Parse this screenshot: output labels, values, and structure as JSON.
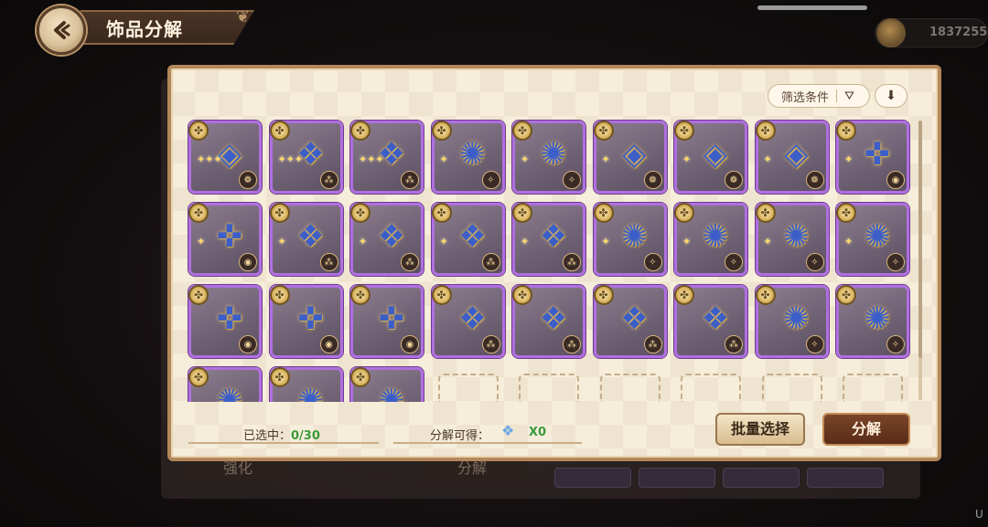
{
  "header": {
    "title": "饰品分解",
    "currency_value": "1837255"
  },
  "toolbar": {
    "filter_label": "筛选条件",
    "filter_icon": "funnel-icon",
    "sort_icon": "down-arrow-icon"
  },
  "items": [
    {
      "kind": "ring",
      "glyph": "◈",
      "badge": "❁",
      "stars": "✦✦✦"
    },
    {
      "kind": "wing",
      "glyph": "❖",
      "badge": "⁂",
      "stars": "✦✦✦"
    },
    {
      "kind": "wing",
      "glyph": "❖",
      "badge": "⁂",
      "stars": "✦✦✦"
    },
    {
      "kind": "wreath",
      "glyph": "✺",
      "badge": "✧",
      "stars": "✦"
    },
    {
      "kind": "wreath",
      "glyph": "✺",
      "badge": "✧",
      "stars": "✦"
    },
    {
      "kind": "ring",
      "glyph": "◈",
      "badge": "❁",
      "stars": "✦"
    },
    {
      "kind": "ring",
      "glyph": "◈",
      "badge": "❁",
      "stars": "✦"
    },
    {
      "kind": "ring",
      "glyph": "◈",
      "badge": "❁",
      "stars": "✦"
    },
    {
      "kind": "staff",
      "glyph": "✜",
      "badge": "◉",
      "stars": "✦"
    },
    {
      "kind": "staff",
      "glyph": "✜",
      "badge": "◉",
      "stars": "✦"
    },
    {
      "kind": "wing",
      "glyph": "❖",
      "badge": "⁂",
      "stars": "✦"
    },
    {
      "kind": "wing",
      "glyph": "❖",
      "badge": "⁂",
      "stars": "✦"
    },
    {
      "kind": "wing",
      "glyph": "❖",
      "badge": "⁂",
      "stars": "✦"
    },
    {
      "kind": "wing",
      "glyph": "❖",
      "badge": "⁂",
      "stars": "✦"
    },
    {
      "kind": "wreath",
      "glyph": "✺",
      "badge": "✧",
      "stars": "✦"
    },
    {
      "kind": "wreath",
      "glyph": "✺",
      "badge": "✧",
      "stars": "✦"
    },
    {
      "kind": "wreath",
      "glyph": "✺",
      "badge": "✧",
      "stars": "✦"
    },
    {
      "kind": "wreath",
      "glyph": "✺",
      "badge": "✧",
      "stars": "✦"
    },
    {
      "kind": "staff",
      "glyph": "✜",
      "badge": "◉",
      "stars": ""
    },
    {
      "kind": "staff",
      "glyph": "✜",
      "badge": "◉",
      "stars": ""
    },
    {
      "kind": "staff",
      "glyph": "✜",
      "badge": "◉",
      "stars": ""
    },
    {
      "kind": "wing",
      "glyph": "❖",
      "badge": "⁂",
      "stars": ""
    },
    {
      "kind": "wing",
      "glyph": "❖",
      "badge": "⁂",
      "stars": ""
    },
    {
      "kind": "wing",
      "glyph": "❖",
      "badge": "⁂",
      "stars": ""
    },
    {
      "kind": "wing",
      "glyph": "❖",
      "badge": "⁂",
      "stars": ""
    },
    {
      "kind": "wreath",
      "glyph": "✺",
      "badge": "✧",
      "stars": ""
    },
    {
      "kind": "wreath",
      "glyph": "✺",
      "badge": "✧",
      "stars": ""
    },
    {
      "kind": "wreath",
      "glyph": "✺",
      "badge": "✧",
      "stars": ""
    },
    {
      "kind": "wreath",
      "glyph": "✺",
      "badge": "✧",
      "stars": ""
    },
    {
      "kind": "wreath",
      "glyph": "✺",
      "badge": "✧",
      "stars": ""
    }
  ],
  "empty_slots": 6,
  "footer": {
    "selected_label": "已选中：",
    "selected_value": "0/30",
    "yield_label": "分解可得：",
    "yield_value": "X0"
  },
  "buttons": {
    "batch_select": "批量选择",
    "decompose": "分解"
  },
  "background": {
    "left_button": "强化",
    "right_button": "分解"
  }
}
